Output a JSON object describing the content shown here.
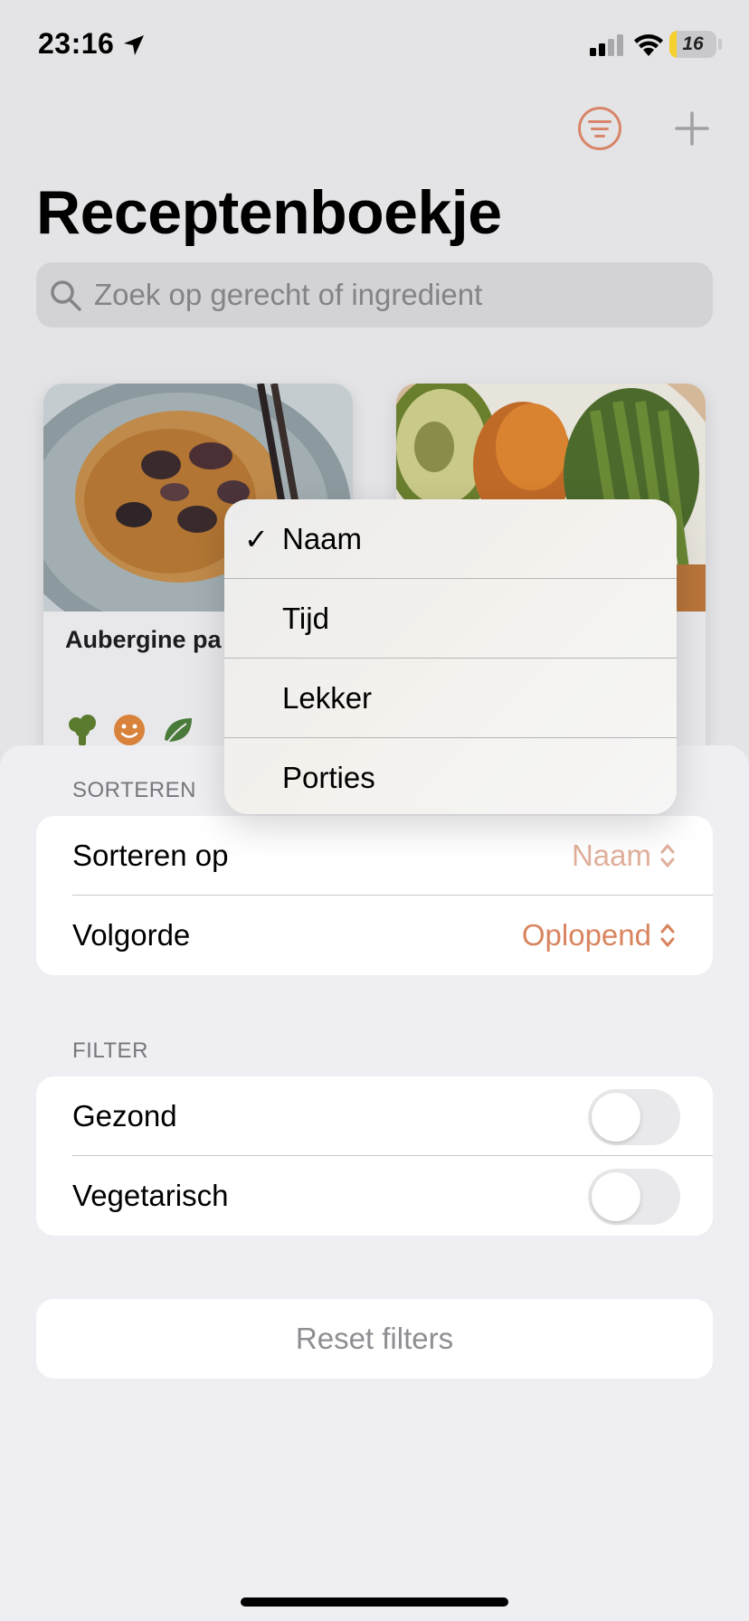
{
  "status_bar": {
    "time": "23:16",
    "battery_level": "16",
    "battery_fraction": 0.16,
    "icons": [
      "location-arrow-icon",
      "cellular-signal-icon",
      "wifi-icon",
      "battery-icon"
    ]
  },
  "nav": {
    "title": "Receptenboekje",
    "accent_color": "#d8856a",
    "icons": [
      "filter-icon",
      "plus-icon"
    ]
  },
  "search": {
    "placeholder": "Zoek op gerecht of ingredient"
  },
  "recipes": [
    {
      "title": "Aubergine pa",
      "tag_icons": [
        "broccoli-icon",
        "smiley-icon",
        "leaf-icon"
      ]
    },
    {
      "title_visible_fragment": "n"
    }
  ],
  "sort_menu": {
    "items": [
      {
        "label": "Naam",
        "checked": true,
        "check": "✓"
      },
      {
        "label": "Tijd",
        "checked": false,
        "check": ""
      },
      {
        "label": "Lekker",
        "checked": false,
        "check": ""
      },
      {
        "label": "Porties",
        "checked": false,
        "check": ""
      }
    ]
  },
  "sheet": {
    "sort_section": {
      "header": "SORTEREN",
      "rows": [
        {
          "label": "Sorteren op",
          "value": "Naam"
        },
        {
          "label": "Volgorde",
          "value": "Oplopend"
        }
      ]
    },
    "filter_section": {
      "header": "FILTER",
      "rows": [
        {
          "label": "Gezond",
          "on": false
        },
        {
          "label": "Vegetarisch",
          "on": false
        }
      ]
    },
    "reset_label": "Reset filters"
  }
}
